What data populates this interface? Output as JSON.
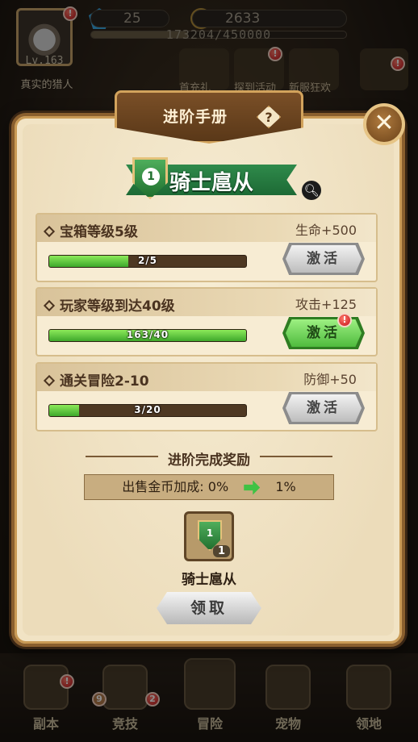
{
  "hud": {
    "level": "Lv.163",
    "player_name": "真实的猎人",
    "gems": "25",
    "coins": "2633",
    "exp": "173204/450000",
    "events": [
      "首充礼",
      "探到活动",
      "新服狂欢"
    ]
  },
  "nav": {
    "items": [
      "副本",
      "竞技",
      "冒险",
      "宠物",
      "领地"
    ],
    "arena_badges": [
      "9",
      "2"
    ]
  },
  "modal": {
    "title": "进阶手册",
    "help": "?",
    "close": "✕",
    "rank_number": "1",
    "rank_title": "骑士扈从",
    "quests": [
      {
        "label": "宝箱等级5级",
        "reward": "生命+500",
        "progress_text": "2/5",
        "progress": 0.4,
        "button": "激活",
        "state": "inactive"
      },
      {
        "label": "玩家等级到达40级",
        "reward": "攻击+125",
        "progress_text": "163/40",
        "progress": 1.0,
        "button": "激活",
        "state": "ready"
      },
      {
        "label": "通关冒险2-10",
        "reward": "防御+50",
        "progress_text": "3/20",
        "progress": 0.15,
        "button": "激活",
        "state": "inactive"
      }
    ],
    "section_title": "进阶完成奖励",
    "bonus": {
      "label": "出售金币加成:",
      "from": "0%",
      "to": "1%"
    },
    "reward_item": {
      "count": "1",
      "name": "骑士扈从",
      "badge": "1"
    },
    "claim_button": "领取"
  },
  "colors": {
    "accent_green": "#3ea82b",
    "frame_brown": "#8a5f2e",
    "parchment": "#f1e3c4"
  }
}
